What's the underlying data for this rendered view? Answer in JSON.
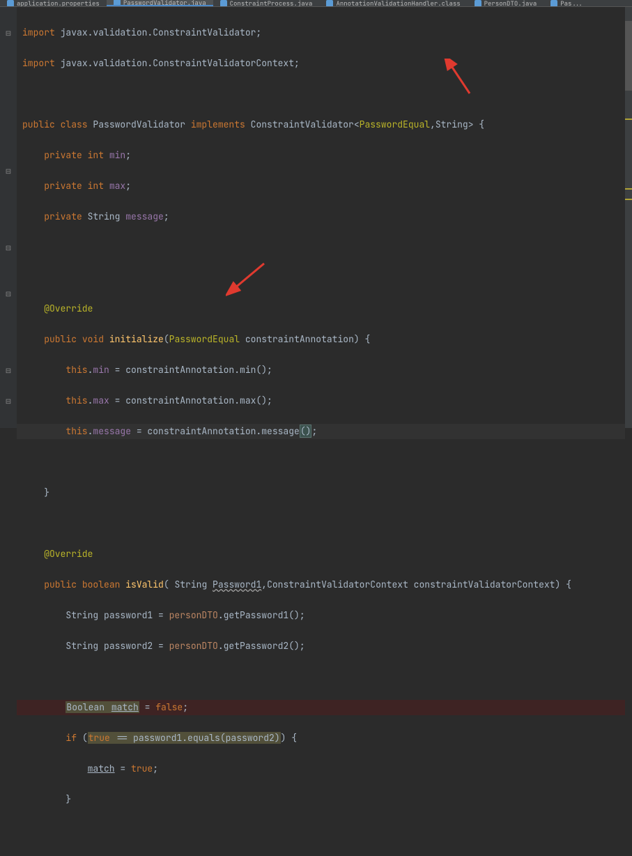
{
  "tabs": [
    {
      "label": "application.properties"
    },
    {
      "label": "PasswordValidator.java",
      "active": true
    },
    {
      "label": "ConstraintProcess.java"
    },
    {
      "label": "AnnotationValidationHandler.class"
    },
    {
      "label": "PersonDTO.java"
    },
    {
      "label": "Pas..."
    }
  ],
  "code": {
    "import1": {
      "kw": "import",
      "pkg": " javax.validation.ConstraintValidator;"
    },
    "import2": {
      "kw": "import",
      "pkg": " javax.validation.ConstraintValidatorContext;"
    },
    "classDecl": {
      "pub": "public ",
      "cls": "class ",
      "name": "PasswordValidator ",
      "impl": "implements ",
      "iface": "ConstraintValidator<",
      "anno": "PasswordEqual",
      "comma": ",",
      "type": "String",
      "end": "> {"
    },
    "fieldMin": {
      "mod": "private ",
      "type": "int ",
      "name": "min",
      "end": ";"
    },
    "fieldMax": {
      "mod": "private ",
      "type": "int ",
      "name": "max",
      "end": ";"
    },
    "fieldMsg": {
      "mod": "private ",
      "type": "String ",
      "name": "message",
      "end": ";"
    },
    "override": "@Override",
    "initDecl": {
      "pub": "public ",
      "void": "void ",
      "fn": "initialize",
      "open": "(",
      "anno": "PasswordEqual",
      "param": " constraintAnnotation) {"
    },
    "assignMin": {
      "thi": "this",
      "dot": ".",
      "fld": "min",
      "eq": " = constraintAnnotation.min();"
    },
    "assignMax": {
      "thi": "this",
      "dot": ".",
      "fld": "max",
      "eq": " = constraintAnnotation.max();"
    },
    "assignMsg": {
      "thi": "this",
      "dot": ".",
      "fld": "message",
      "eq": " = constraintAnnotation.message",
      "p": "()",
      "end": ";"
    },
    "closeBrace": "}",
    "isValidDecl": {
      "pub": "public ",
      "bool": "boolean ",
      "fn": "isValid",
      "open": "( ",
      "t1": "String ",
      "p1": "Password1",
      "comma": ",",
      "t2": "ConstraintValidatorContext ",
      "p2": "constraintValidatorContext) {"
    },
    "pw1": {
      "type": "String ",
      "var": "password1 = ",
      "ref": "personDTO",
      "call": ".getPassword1();"
    },
    "pw2": {
      "type": "String ",
      "var": "password2 = ",
      "ref": "personDTO",
      "call": ".getPassword2();"
    },
    "match": {
      "type": "Boolean ",
      "var": "match",
      "eq": " = ",
      "val": "false",
      "end": ";"
    },
    "ifLine": {
      "if": "if ",
      "open": "(",
      "tru": "true",
      "cond": " == password1.equals(password2)",
      "close": ")",
      "end": " {"
    },
    "matchTrue": {
      "var": "match",
      "eq": " = ",
      "val": "true",
      "end": ";"
    },
    "closeBrace2": "}"
  }
}
